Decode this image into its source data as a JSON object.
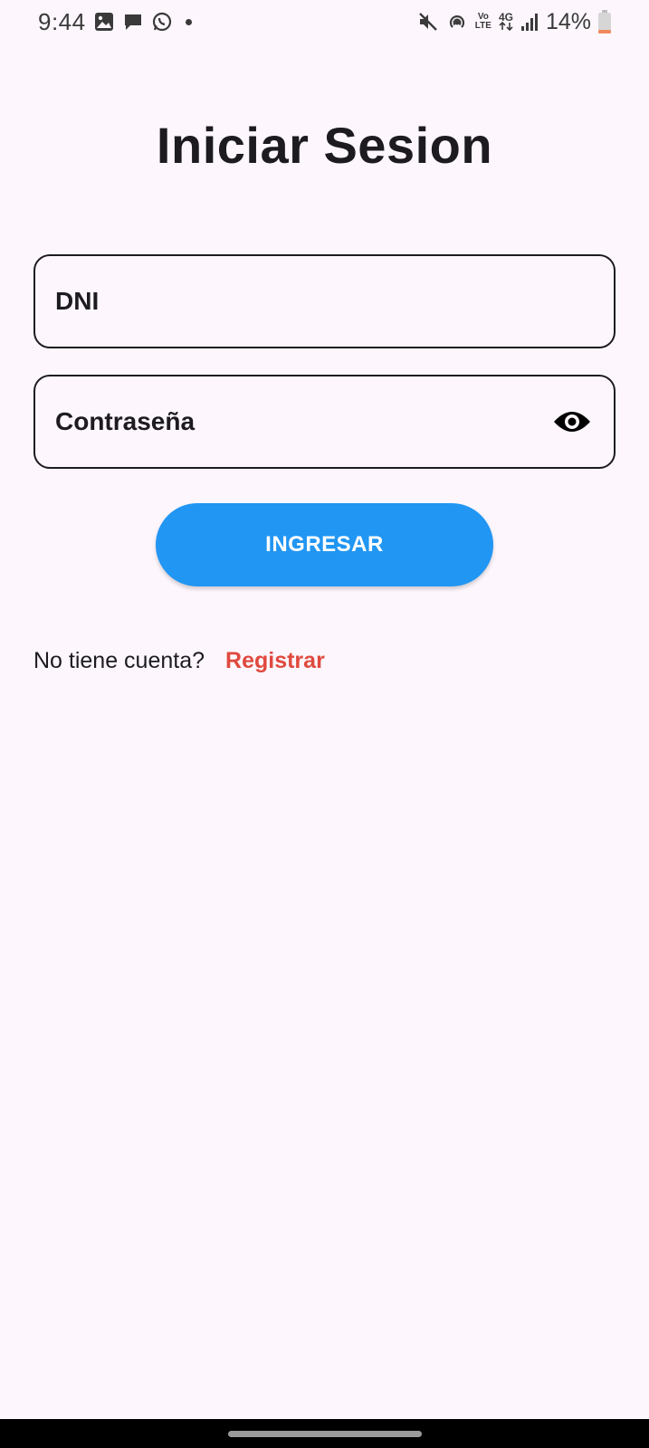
{
  "status_bar": {
    "time": "9:44",
    "battery_percent": "14%",
    "battery_level": 0.14,
    "network_type": "4G",
    "volte_label_top": "Vo",
    "volte_label_bottom": "LTE",
    "left_icons": [
      "gallery-icon",
      "chat-icon",
      "whatsapp-icon",
      "dot-icon"
    ],
    "right_icons": [
      "mute-icon",
      "hotspot-icon",
      "volte-icon",
      "4g-icon",
      "signal-icon",
      "battery-icon"
    ]
  },
  "login": {
    "title": "Iniciar Sesion",
    "dni_label": "DNI",
    "password_label": "Contraseña",
    "password_toggle_icon": "eye-icon",
    "submit_label": "INGRESAR",
    "register_prompt": "No tiene cuenta?",
    "register_link": "Registrar"
  },
  "colors": {
    "background": "#fdf7fd",
    "primary_button": "#2196f3",
    "link": "#e0493e",
    "text": "#1d1b20"
  }
}
